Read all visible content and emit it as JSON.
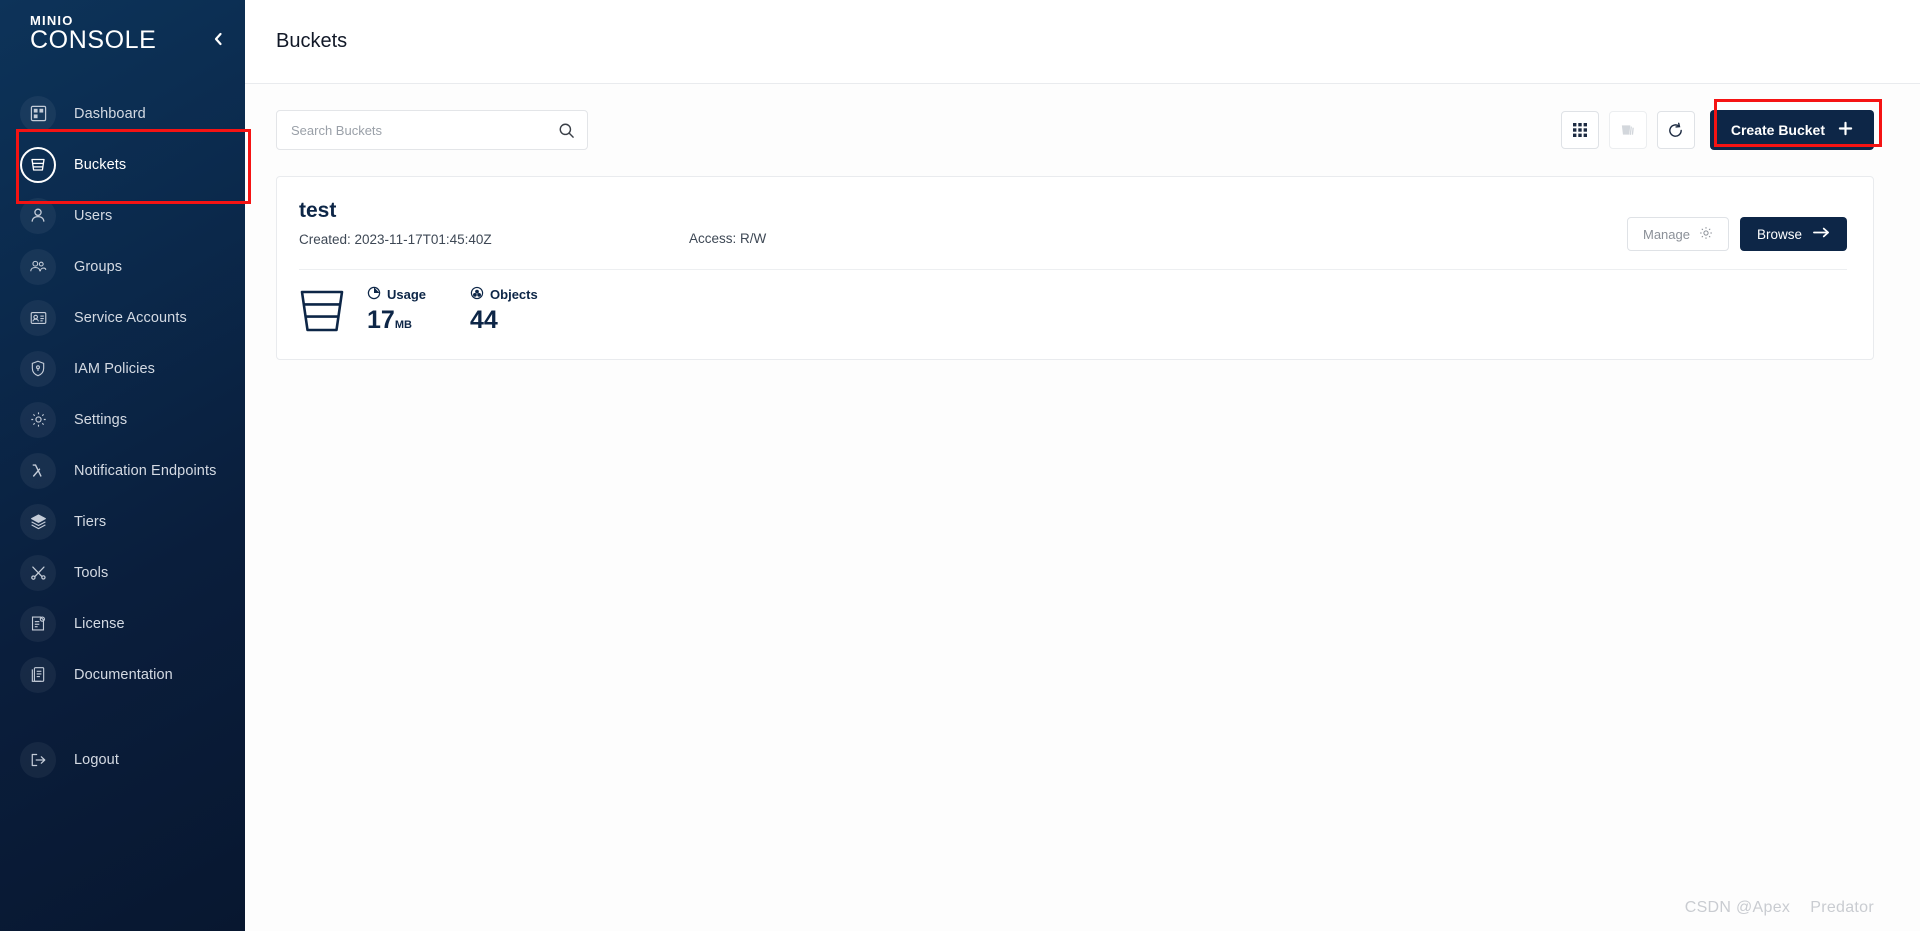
{
  "sidebar": {
    "logo_top": "MINIO",
    "logo_bottom": "CONSOLE",
    "collapse_icon": "chevron-left-icon",
    "items": [
      {
        "label": "Dashboard",
        "icon": "dashboard-icon",
        "active": false
      },
      {
        "label": "Buckets",
        "icon": "bucket-icon",
        "active": true
      },
      {
        "label": "Users",
        "icon": "user-icon",
        "active": false
      },
      {
        "label": "Groups",
        "icon": "groups-icon",
        "active": false
      },
      {
        "label": "Service Accounts",
        "icon": "id-card-icon",
        "active": false
      },
      {
        "label": "IAM Policies",
        "icon": "shield-icon",
        "active": false
      },
      {
        "label": "Settings",
        "icon": "gear-icon",
        "active": false
      },
      {
        "label": "Notification Endpoints",
        "icon": "lambda-icon",
        "active": false
      },
      {
        "label": "Tiers",
        "icon": "layers-icon",
        "active": false
      },
      {
        "label": "Tools",
        "icon": "tools-icon",
        "active": false
      },
      {
        "label": "License",
        "icon": "license-icon",
        "active": false
      },
      {
        "label": "Documentation",
        "icon": "book-icon",
        "active": false
      }
    ],
    "logout": {
      "label": "Logout",
      "icon": "logout-icon"
    }
  },
  "header": {
    "title": "Buckets"
  },
  "toolbar": {
    "search_placeholder": "Search Buckets",
    "search_value": "",
    "search_icon": "search-icon",
    "grid_view_icon": "grid-view-icon",
    "delete_icon": "delete-bucket-icon",
    "refresh_icon": "refresh-icon",
    "create_label": "Create Bucket",
    "create_icon": "plus-icon"
  },
  "buckets": [
    {
      "name": "test",
      "created_label": "Created: 2023-11-17T01:45:40Z",
      "access_label": "Access: R/W",
      "manage_label": "Manage",
      "manage_icon": "gear-icon",
      "browse_label": "Browse",
      "browse_icon": "arrow-right-icon",
      "usage_label": "Usage",
      "usage_icon": "pie-icon",
      "usage_value": "17",
      "usage_unit": "MB",
      "objects_label": "Objects",
      "objects_icon": "objects-icon",
      "objects_value": "44"
    }
  ],
  "watermark": {
    "left": "CSDN @Apex",
    "right": "Predator"
  },
  "colors": {
    "sidebar_dark": "#0a1e3c",
    "accent_navy": "#0d2647",
    "annotation_red": "#f51313"
  }
}
